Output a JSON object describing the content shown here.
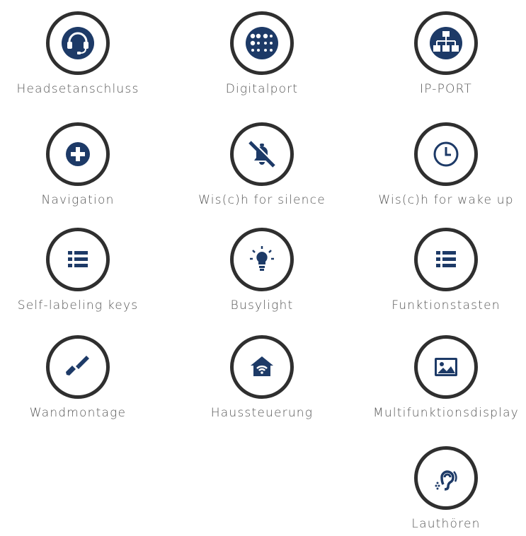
{
  "accent_color": "#1d3a67",
  "ring_color": "#2f2f2f",
  "features": [
    {
      "label": "Headsetanschluss",
      "icon": "headset-icon"
    },
    {
      "label": "Digitalport",
      "icon": "dot-grid-icon"
    },
    {
      "label": "IP-PORT",
      "icon": "network-icon"
    },
    {
      "label": "Navigation",
      "icon": "plus-circle-icon"
    },
    {
      "label": "Wis(c)h for silence",
      "icon": "bell-slash-icon"
    },
    {
      "label": "Wis(c)h for wake up",
      "icon": "clock-icon"
    },
    {
      "label": "Self-labeling keys",
      "icon": "list-icon"
    },
    {
      "label": "Busylight",
      "icon": "lightbulb-icon"
    },
    {
      "label": "Funktionstasten",
      "icon": "list-icon"
    },
    {
      "label": "Wandmontage",
      "icon": "screwdriver-icon"
    },
    {
      "label": "Haussteuerung",
      "icon": "smart-home-icon"
    },
    {
      "label": "Multifunktionsdisplay",
      "icon": "picture-icon"
    },
    {
      "label": "Lauthören",
      "icon": "hearing-icon"
    }
  ]
}
